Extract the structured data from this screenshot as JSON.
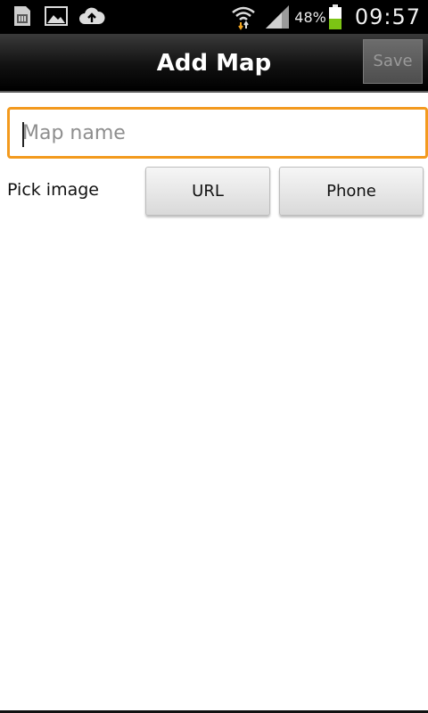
{
  "status_bar": {
    "icons_left": [
      "sim-card-icon",
      "image-icon",
      "cloud-upload-icon"
    ],
    "icons_right": [
      "wifi-icon",
      "signal-icon",
      "battery-icon"
    ],
    "battery_percent": "48%",
    "battery_level": 0.48,
    "time": "09:57",
    "colors": {
      "battery_fill": "#7cc414",
      "wifi_arrow": "#f1a41f"
    }
  },
  "action_bar": {
    "title": "Add Map",
    "save_label": "Save"
  },
  "form": {
    "map_name": {
      "value": "",
      "placeholder": "Map name"
    },
    "pick_image_label": "Pick image",
    "url_button_label": "URL",
    "phone_button_label": "Phone"
  },
  "colors": {
    "focus_border": "#f39a1e",
    "action_bar_bg": "#000000"
  }
}
